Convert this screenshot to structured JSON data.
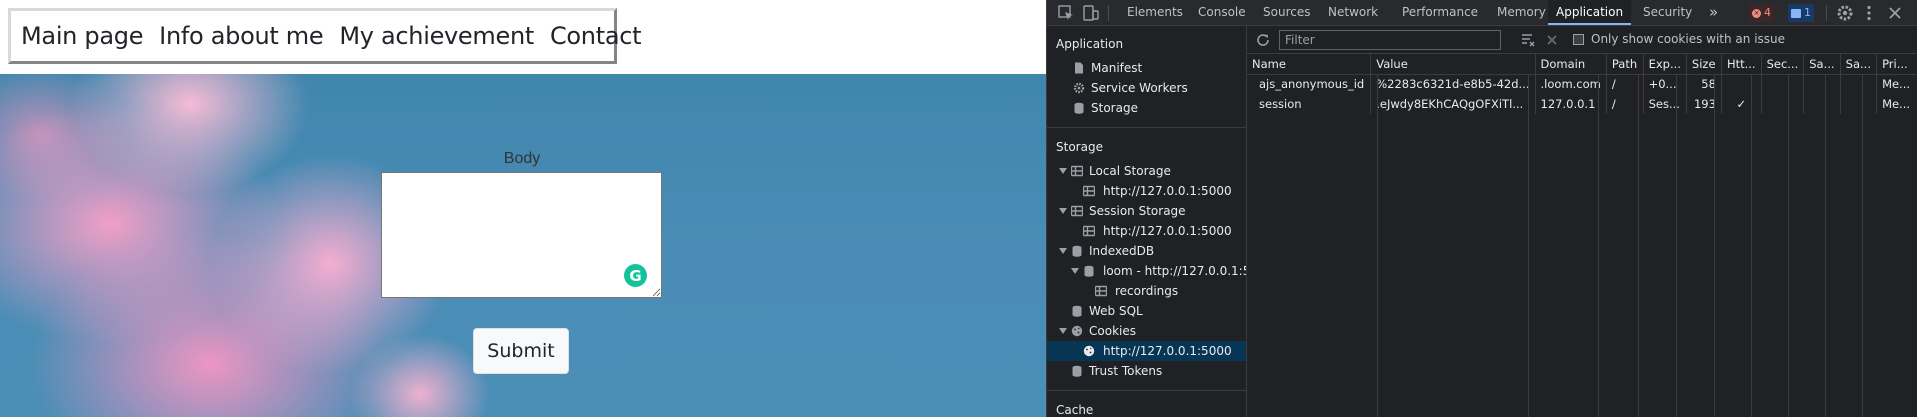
{
  "nav": {
    "items": [
      "Main page",
      "Info about me",
      "My achievement",
      "Contact"
    ]
  },
  "form": {
    "body_label": "Body",
    "body_value": "",
    "submit_label": "Submit"
  },
  "devtools": {
    "tabs": [
      "Elements",
      "Console",
      "Sources",
      "Network",
      "Performance",
      "Memory",
      "Application",
      "Security"
    ],
    "active_tab": "Application",
    "more_tabs": "»",
    "error_count": "4",
    "message_count": "1",
    "sidebar": {
      "application_title": "Application",
      "application_items": [
        "Manifest",
        "Service Workers",
        "Storage"
      ],
      "storage_title": "Storage",
      "local_storage": "Local Storage",
      "local_storage_origin": "http://127.0.0.1:5000",
      "session_storage": "Session Storage",
      "session_storage_origin": "http://127.0.0.1:5000",
      "indexeddb": "IndexedDB",
      "indexeddb_db": "loom - http://127.0.0.1:5000",
      "indexeddb_store": "recordings",
      "websql": "Web SQL",
      "cookies": "Cookies",
      "cookies_origin": "http://127.0.0.1:5000",
      "trust_tokens": "Trust Tokens",
      "cache_title": "Cache"
    },
    "filter": {
      "placeholder": "Filter",
      "only_issue_label": "Only show cookies with an issue"
    },
    "columns": [
      "Name",
      "Value",
      "Domain",
      "Path",
      "Exp...",
      "Size",
      "Htt...",
      "Sec...",
      "Sa...",
      "Sa...",
      "Pri..."
    ],
    "rows": [
      [
        "ajs_anonymous_id",
        "%2283c6321d-e8b5-42d...",
        ".loom.com",
        "/",
        "+0...",
        "58",
        "",
        "",
        "",
        "",
        "Me..."
      ],
      [
        "session",
        ".eJwdy8EKhCAQgOFXiTl...",
        "127.0.0.1",
        "/",
        "Ses...",
        "193",
        "✓",
        "",
        "",
        "",
        "Me..."
      ]
    ]
  }
}
